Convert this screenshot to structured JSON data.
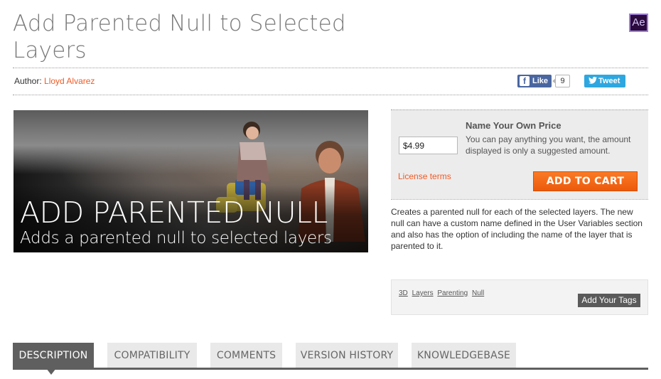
{
  "page": {
    "title": "Add Parented Null to Selected Layers",
    "app_badge": "Ae"
  },
  "author": {
    "label": "Author:",
    "name": "Lloyd Alvarez"
  },
  "social": {
    "like_label": "Like",
    "like_count": "9",
    "tweet_label": "Tweet"
  },
  "hero": {
    "headline": "ADD PARENTED NULL",
    "subheadline": "Adds a parented null to selected layers"
  },
  "pricing": {
    "price_value": "$4.99",
    "title": "Name Your Own Price",
    "description": "You can pay anything you want, the amount displayed is only a suggested amount.",
    "license_link": "License terms",
    "add_to_cart": "ADD TO CART"
  },
  "description": "Creates a parented null for each of the selected layers. The new null can have a custom name defined in the User Variables section and also has the option of including the name of the layer that is parented to it.",
  "tags": {
    "items": [
      "3D",
      "Layers",
      "Parenting",
      "Null"
    ],
    "add_label": "Add Your Tags"
  },
  "tabs": [
    {
      "label": "DESCRIPTION",
      "active": true
    },
    {
      "label": "COMPATIBILITY",
      "active": false
    },
    {
      "label": "COMMENTS",
      "active": false
    },
    {
      "label": "VERSION HISTORY",
      "active": false
    },
    {
      "label": "KNOWLEDGEBASE",
      "active": false
    }
  ],
  "colors": {
    "accent": "#f15a24",
    "cart_button": "#f26a1b",
    "tab_active": "#5f5f5f",
    "tab_inactive": "#e9e9e9"
  }
}
